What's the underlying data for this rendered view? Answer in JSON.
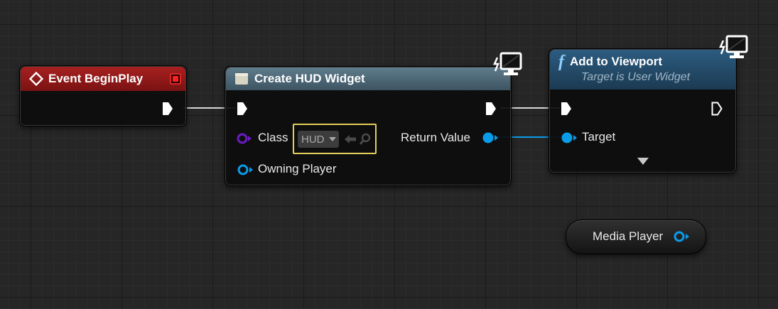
{
  "colors": {
    "event_header": "#8a1616",
    "function_header": "#26506e",
    "macro_header": "#4a6474",
    "object_pin": "#0a9ce8",
    "class_pin": "#5a17a8",
    "selection_outline": "#e3cf5a"
  },
  "event_node": {
    "title": "Event BeginPlay",
    "header_icon": "event-diamond-icon",
    "delegate_icon": "delegate-square-icon"
  },
  "create_widget_node": {
    "title": "Create HUD Widget",
    "header_icon": "widget-icon",
    "corner_icon": "client-monitor-icon",
    "class_label": "Class",
    "class_value": "HUD",
    "return_label": "Return Value",
    "owning_label": "Owning Player"
  },
  "add_viewport_node": {
    "title": "Add to Viewport",
    "subtitle": "Target is User Widget",
    "header_icon": "function-f-icon",
    "corner_icon": "client-monitor-icon",
    "target_label": "Target",
    "expand_icon": "expand-arrow-icon"
  },
  "media_player_node": {
    "label": "Media Player"
  }
}
